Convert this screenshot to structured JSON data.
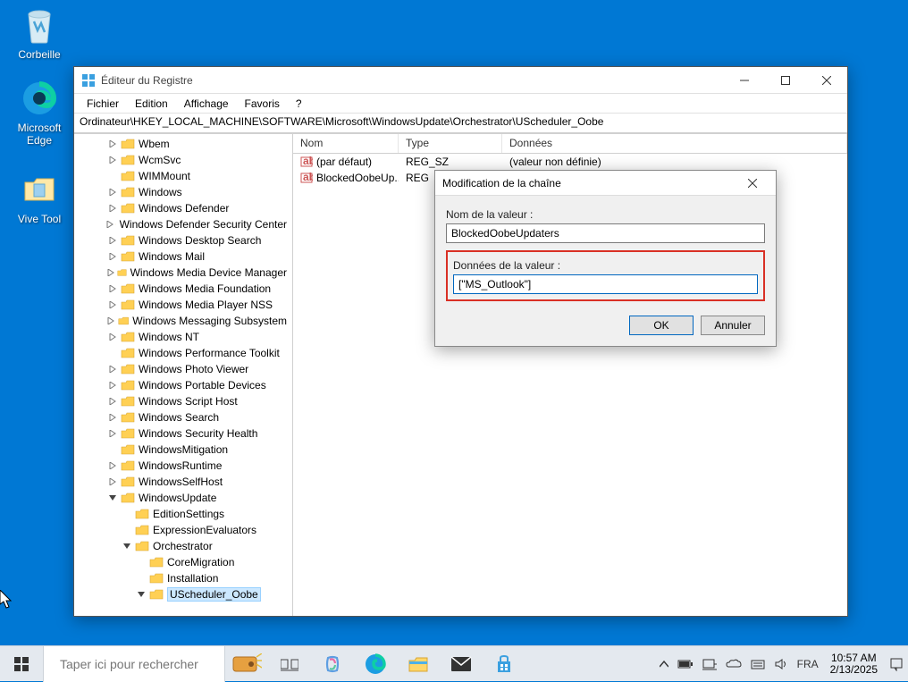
{
  "desktop": {
    "icons": [
      {
        "name": "recycle-bin",
        "label": "Corbeille"
      },
      {
        "name": "edge",
        "label": "Microsoft Edge"
      },
      {
        "name": "folder",
        "label": "Vive Tool"
      }
    ]
  },
  "window": {
    "title": "Éditeur du Registre",
    "menu": [
      "Fichier",
      "Edition",
      "Affichage",
      "Favoris",
      "?"
    ],
    "address": "Ordinateur\\HKEY_LOCAL_MACHINE\\SOFTWARE\\Microsoft\\WindowsUpdate\\Orchestrator\\UScheduler_Oobe",
    "tree": [
      {
        "label": "Wbem",
        "level": 2,
        "exp": ">"
      },
      {
        "label": "WcmSvc",
        "level": 2,
        "exp": ">"
      },
      {
        "label": "WIMMount",
        "level": 2,
        "exp": ""
      },
      {
        "label": "Windows",
        "level": 2,
        "exp": ">"
      },
      {
        "label": "Windows Defender",
        "level": 2,
        "exp": ">"
      },
      {
        "label": "Windows Defender Security Center",
        "level": 2,
        "exp": ">"
      },
      {
        "label": "Windows Desktop Search",
        "level": 2,
        "exp": ">"
      },
      {
        "label": "Windows Mail",
        "level": 2,
        "exp": ">"
      },
      {
        "label": "Windows Media Device Manager",
        "level": 2,
        "exp": ">"
      },
      {
        "label": "Windows Media Foundation",
        "level": 2,
        "exp": ">"
      },
      {
        "label": "Windows Media Player NSS",
        "level": 2,
        "exp": ">"
      },
      {
        "label": "Windows Messaging Subsystem",
        "level": 2,
        "exp": ">"
      },
      {
        "label": "Windows NT",
        "level": 2,
        "exp": ">"
      },
      {
        "label": "Windows Performance Toolkit",
        "level": 2,
        "exp": ""
      },
      {
        "label": "Windows Photo Viewer",
        "level": 2,
        "exp": ">"
      },
      {
        "label": "Windows Portable Devices",
        "level": 2,
        "exp": ">"
      },
      {
        "label": "Windows Script Host",
        "level": 2,
        "exp": ">"
      },
      {
        "label": "Windows Search",
        "level": 2,
        "exp": ">"
      },
      {
        "label": "Windows Security Health",
        "level": 2,
        "exp": ">"
      },
      {
        "label": "WindowsMitigation",
        "level": 2,
        "exp": ""
      },
      {
        "label": "WindowsRuntime",
        "level": 2,
        "exp": ">"
      },
      {
        "label": "WindowsSelfHost",
        "level": 2,
        "exp": ">"
      },
      {
        "label": "WindowsUpdate",
        "level": 2,
        "exp": "v"
      },
      {
        "label": "EditionSettings",
        "level": 3,
        "exp": ""
      },
      {
        "label": "ExpressionEvaluators",
        "level": 3,
        "exp": ""
      },
      {
        "label": "Orchestrator",
        "level": 3,
        "exp": "v"
      },
      {
        "label": "CoreMigration",
        "level": 4,
        "exp": ""
      },
      {
        "label": "Installation",
        "level": 4,
        "exp": ""
      },
      {
        "label": "UScheduler_Oobe",
        "level": 4,
        "exp": "v",
        "selected": true
      }
    ],
    "columns": {
      "nom": "Nom",
      "type": "Type",
      "data": "Données"
    },
    "rows": [
      {
        "name": "(par défaut)",
        "type": "REG_SZ",
        "data": "(valeur non définie)"
      },
      {
        "name": "BlockedOobeUp...",
        "type": "REG",
        "data": ""
      }
    ]
  },
  "dialog": {
    "title": "Modification de la chaîne",
    "name_label": "Nom de la valeur :",
    "name_value": "BlockedOobeUpdaters",
    "data_label": "Données de la valeur :",
    "data_value": "[\"MS_Outlook\"]",
    "ok": "OK",
    "cancel": "Annuler"
  },
  "taskbar": {
    "search_placeholder": "Taper ici pour rechercher",
    "lang": "FRA",
    "time": "10:57 AM",
    "date": "2/13/2025"
  }
}
